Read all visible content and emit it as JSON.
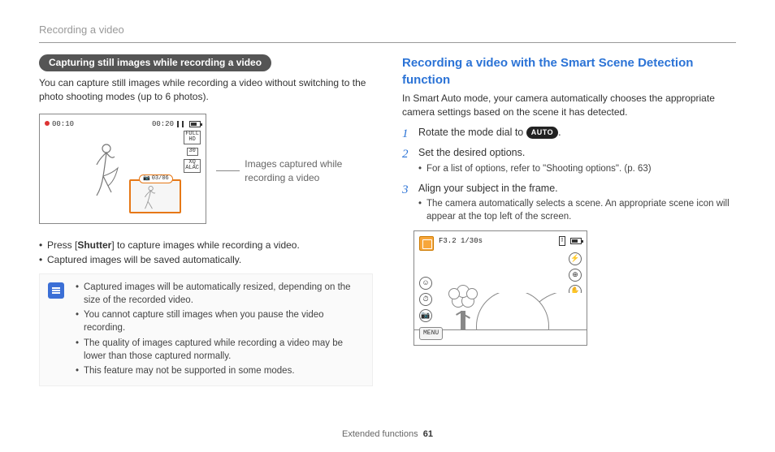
{
  "breadcrumb": "Recording a video",
  "left": {
    "pill": "Capturing still images while recording a video",
    "intro": "You can capture still images while recording a video without switching to the photo shooting modes (up to 6 photos).",
    "lcd": {
      "elapsed": "00:10",
      "remaining": "00:20",
      "right_icons": [
        "FULL\nHD",
        "30",
        "XQ\nALAC"
      ],
      "thumb_counter": "03/06"
    },
    "callout": "Images captured while recording a video",
    "bullets": [
      "Press [Shutter] to capture images while recording a video.",
      "Captured images will be saved automatically."
    ],
    "bullet_shutter_prefix": "Press [",
    "bullet_shutter_word": "Shutter",
    "bullet_shutter_suffix": "] to capture images while recording a video.",
    "note": [
      "Captured images will be automatically resized, depending on the size of the recorded video.",
      "You cannot capture still images when you pause the video recording.",
      "The quality of images captured while recording a video may be lower than those captured normally.",
      "This feature may not be supported in some modes."
    ]
  },
  "right": {
    "heading": "Recording a video with the Smart Scene Detection function",
    "intro": "In Smart Auto mode, your camera automatically chooses the appropriate camera settings based on the scene it has detected.",
    "steps": {
      "s1_prefix": "Rotate the mode dial to ",
      "s1_badge": "AUTO",
      "s1_suffix": ".",
      "s2": "Set the desired options.",
      "s2_sub": "For a list of options, refer to \"Shooting options\". (p. 63)",
      "s3": "Align your subject in the frame.",
      "s3_sub": "The camera automatically selects a scene. An appropriate scene icon will appear at the top left of the screen."
    },
    "lcd2": {
      "exposure": "F3.2 1/30s",
      "menu": "MENU"
    }
  },
  "footer": {
    "label": "Extended functions",
    "page": "61"
  }
}
